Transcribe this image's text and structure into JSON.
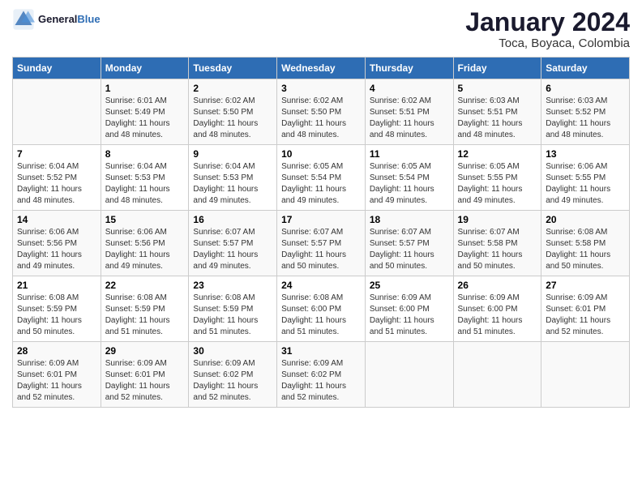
{
  "logo": {
    "text_general": "General",
    "text_blue": "Blue"
  },
  "title": "January 2024",
  "subtitle": "Toca, Boyaca, Colombia",
  "days_of_week": [
    "Sunday",
    "Monday",
    "Tuesday",
    "Wednesday",
    "Thursday",
    "Friday",
    "Saturday"
  ],
  "weeks": [
    [
      {
        "day": "",
        "info": ""
      },
      {
        "day": "1",
        "info": "Sunrise: 6:01 AM\nSunset: 5:49 PM\nDaylight: 11 hours\nand 48 minutes."
      },
      {
        "day": "2",
        "info": "Sunrise: 6:02 AM\nSunset: 5:50 PM\nDaylight: 11 hours\nand 48 minutes."
      },
      {
        "day": "3",
        "info": "Sunrise: 6:02 AM\nSunset: 5:50 PM\nDaylight: 11 hours\nand 48 minutes."
      },
      {
        "day": "4",
        "info": "Sunrise: 6:02 AM\nSunset: 5:51 PM\nDaylight: 11 hours\nand 48 minutes."
      },
      {
        "day": "5",
        "info": "Sunrise: 6:03 AM\nSunset: 5:51 PM\nDaylight: 11 hours\nand 48 minutes."
      },
      {
        "day": "6",
        "info": "Sunrise: 6:03 AM\nSunset: 5:52 PM\nDaylight: 11 hours\nand 48 minutes."
      }
    ],
    [
      {
        "day": "7",
        "info": "Sunrise: 6:04 AM\nSunset: 5:52 PM\nDaylight: 11 hours\nand 48 minutes."
      },
      {
        "day": "8",
        "info": "Sunrise: 6:04 AM\nSunset: 5:53 PM\nDaylight: 11 hours\nand 48 minutes."
      },
      {
        "day": "9",
        "info": "Sunrise: 6:04 AM\nSunset: 5:53 PM\nDaylight: 11 hours\nand 49 minutes."
      },
      {
        "day": "10",
        "info": "Sunrise: 6:05 AM\nSunset: 5:54 PM\nDaylight: 11 hours\nand 49 minutes."
      },
      {
        "day": "11",
        "info": "Sunrise: 6:05 AM\nSunset: 5:54 PM\nDaylight: 11 hours\nand 49 minutes."
      },
      {
        "day": "12",
        "info": "Sunrise: 6:05 AM\nSunset: 5:55 PM\nDaylight: 11 hours\nand 49 minutes."
      },
      {
        "day": "13",
        "info": "Sunrise: 6:06 AM\nSunset: 5:55 PM\nDaylight: 11 hours\nand 49 minutes."
      }
    ],
    [
      {
        "day": "14",
        "info": "Sunrise: 6:06 AM\nSunset: 5:56 PM\nDaylight: 11 hours\nand 49 minutes."
      },
      {
        "day": "15",
        "info": "Sunrise: 6:06 AM\nSunset: 5:56 PM\nDaylight: 11 hours\nand 49 minutes."
      },
      {
        "day": "16",
        "info": "Sunrise: 6:07 AM\nSunset: 5:57 PM\nDaylight: 11 hours\nand 49 minutes."
      },
      {
        "day": "17",
        "info": "Sunrise: 6:07 AM\nSunset: 5:57 PM\nDaylight: 11 hours\nand 50 minutes."
      },
      {
        "day": "18",
        "info": "Sunrise: 6:07 AM\nSunset: 5:57 PM\nDaylight: 11 hours\nand 50 minutes."
      },
      {
        "day": "19",
        "info": "Sunrise: 6:07 AM\nSunset: 5:58 PM\nDaylight: 11 hours\nand 50 minutes."
      },
      {
        "day": "20",
        "info": "Sunrise: 6:08 AM\nSunset: 5:58 PM\nDaylight: 11 hours\nand 50 minutes."
      }
    ],
    [
      {
        "day": "21",
        "info": "Sunrise: 6:08 AM\nSunset: 5:59 PM\nDaylight: 11 hours\nand 50 minutes."
      },
      {
        "day": "22",
        "info": "Sunrise: 6:08 AM\nSunset: 5:59 PM\nDaylight: 11 hours\nand 51 minutes."
      },
      {
        "day": "23",
        "info": "Sunrise: 6:08 AM\nSunset: 5:59 PM\nDaylight: 11 hours\nand 51 minutes."
      },
      {
        "day": "24",
        "info": "Sunrise: 6:08 AM\nSunset: 6:00 PM\nDaylight: 11 hours\nand 51 minutes."
      },
      {
        "day": "25",
        "info": "Sunrise: 6:09 AM\nSunset: 6:00 PM\nDaylight: 11 hours\nand 51 minutes."
      },
      {
        "day": "26",
        "info": "Sunrise: 6:09 AM\nSunset: 6:00 PM\nDaylight: 11 hours\nand 51 minutes."
      },
      {
        "day": "27",
        "info": "Sunrise: 6:09 AM\nSunset: 6:01 PM\nDaylight: 11 hours\nand 52 minutes."
      }
    ],
    [
      {
        "day": "28",
        "info": "Sunrise: 6:09 AM\nSunset: 6:01 PM\nDaylight: 11 hours\nand 52 minutes."
      },
      {
        "day": "29",
        "info": "Sunrise: 6:09 AM\nSunset: 6:01 PM\nDaylight: 11 hours\nand 52 minutes."
      },
      {
        "day": "30",
        "info": "Sunrise: 6:09 AM\nSunset: 6:02 PM\nDaylight: 11 hours\nand 52 minutes."
      },
      {
        "day": "31",
        "info": "Sunrise: 6:09 AM\nSunset: 6:02 PM\nDaylight: 11 hours\nand 52 minutes."
      },
      {
        "day": "",
        "info": ""
      },
      {
        "day": "",
        "info": ""
      },
      {
        "day": "",
        "info": ""
      }
    ]
  ]
}
